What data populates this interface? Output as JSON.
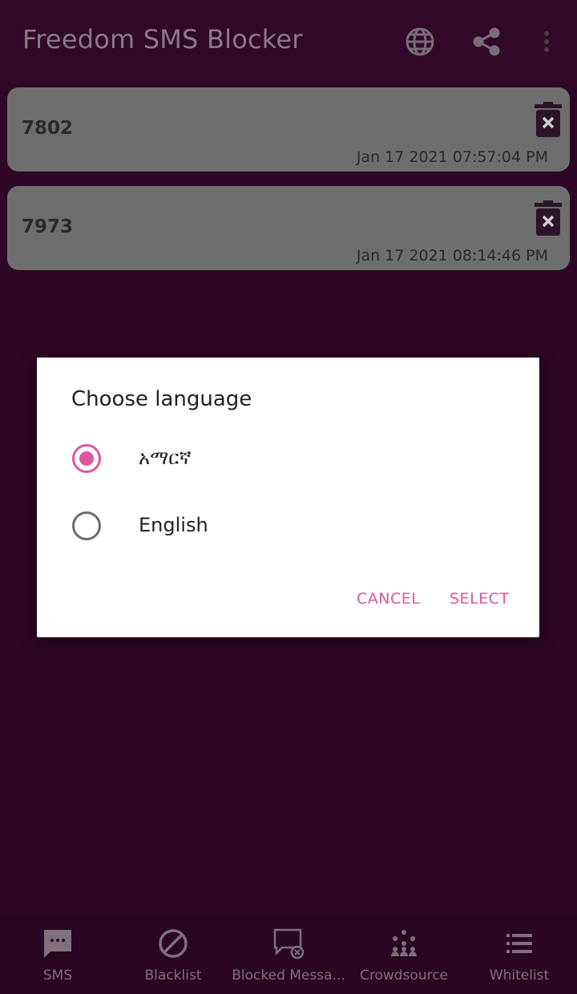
{
  "app": {
    "title": "Freedom SMS Blocker",
    "actions": [
      {
        "name": "language",
        "icon": "globe-icon"
      },
      {
        "name": "share",
        "icon": "share-icon"
      },
      {
        "name": "more",
        "icon": "more-vert-icon"
      }
    ]
  },
  "entries": [
    {
      "number": "7802",
      "timestamp": "Jan 17 2021 07:57:04 PM",
      "action_icon": "delete-icon"
    },
    {
      "number": "7973",
      "timestamp": "Jan 17 2021 08:14:46 PM",
      "action_icon": "delete-icon"
    }
  ],
  "dialog": {
    "title": "Choose language",
    "options": [
      {
        "label": "አማርኛ",
        "selected": true
      },
      {
        "label": "English",
        "selected": false
      }
    ],
    "cancel_label": "CANCEL",
    "select_label": "SELECT"
  },
  "bottom_nav": {
    "items": [
      {
        "label": "SMS",
        "icon": "sms-icon"
      },
      {
        "label": "Blacklist",
        "icon": "block-icon"
      },
      {
        "label": "Blocked Messa...",
        "icon": "blocked-message-icon"
      },
      {
        "label": "Crowdsource",
        "icon": "crowdsource-icon"
      },
      {
        "label": "Whitelist",
        "icon": "list-icon"
      }
    ]
  },
  "colors": {
    "background": "#2e0726",
    "accent": "#e0569f",
    "card": "#6e6e6e",
    "nav_icon": "#7f707b"
  }
}
